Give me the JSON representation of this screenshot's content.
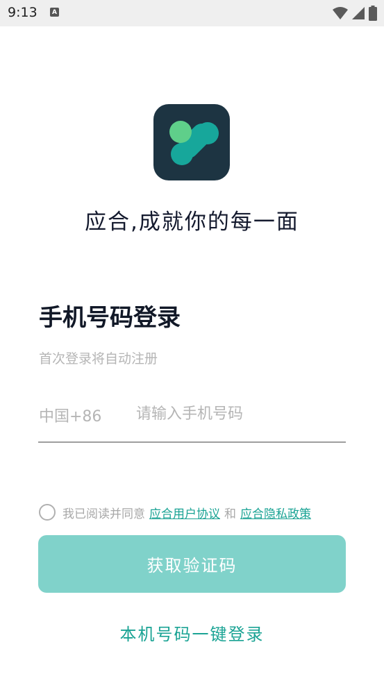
{
  "status_bar": {
    "time": "9:13",
    "notification_icon_letter": "A"
  },
  "app": {
    "slogan": "应合,成就你的每一面"
  },
  "login": {
    "title": "手机号码登录",
    "subtitle": "首次登录将自动注册",
    "country_code": "中国+86",
    "phone_placeholder": "请输入手机号码",
    "phone_value": ""
  },
  "agreement": {
    "prefix": "我已阅读并同意",
    "user_agreement": "应合用户协议",
    "connector": "和",
    "privacy_policy": "应合隐私政策",
    "checked": false
  },
  "buttons": {
    "get_code": "获取验证码",
    "one_click_login": "本机号码一键登录"
  },
  "colors": {
    "logo_bg": "#1d3442",
    "logo_light_green": "#5fcf8a",
    "logo_teal": "#17a79b",
    "accent": "#1aa394",
    "button_bg": "#80d2ca"
  }
}
